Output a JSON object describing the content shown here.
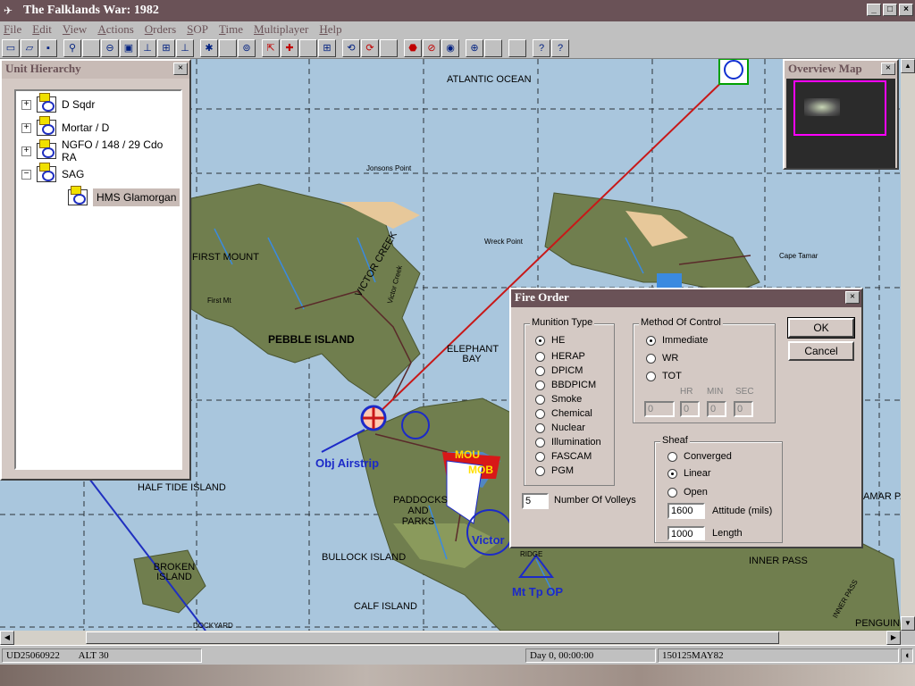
{
  "window": {
    "title": "The Falklands War: 1982",
    "min": "_",
    "max": "□",
    "close": "×"
  },
  "menu": [
    "File",
    "Edit",
    "View",
    "Actions",
    "Orders",
    "SOP",
    "Time",
    "Multiplayer",
    "Help"
  ],
  "toolbar_icons": [
    "new-icon",
    "open-icon",
    "save-icon",
    "binoculars-icon",
    "blank-icon",
    "zoom-icon",
    "select-icon",
    "unit-icon",
    "org-icon",
    "org2-icon",
    "org3-icon",
    "sun-icon",
    "blank2-icon",
    "clock-icon",
    "move-icon",
    "add-icon",
    "blank3-icon",
    "grid-icon",
    "cycle-icon",
    "cycle2-icon",
    "blank4-icon",
    "stop-icon",
    "cancel-icon",
    "eye-icon",
    "target-icon",
    "blank5-icon",
    "blank6-icon",
    "help-icon",
    "whatsthis-icon"
  ],
  "hierarchy": {
    "title": "Unit Hierarchy",
    "items": [
      {
        "label": "D Sqdr",
        "expander": "+"
      },
      {
        "label": "Mortar / D",
        "expander": "+"
      },
      {
        "label": "NGFO / 148 / 29 Cdo RA",
        "expander": "+"
      },
      {
        "label": "SAG",
        "expander": "−"
      },
      {
        "label": "HMS Glamorgan",
        "expander": ""
      }
    ]
  },
  "overview": {
    "title": "Overview Map"
  },
  "map_labels": {
    "atlantic": "ATLANTIC OCEAN",
    "jonsons": "Jonsons Point",
    "wreck": "Wreck Point",
    "cape": "Cape Tamar",
    "first_mount": "FIRST MOUNT",
    "first_mt": "First Mt",
    "victor_creek": "VICTOR CREEK",
    "victor_creek2": "Victor Creek",
    "pebble": "PEBBLE ISLAND",
    "elephant": "ELEPHANT BAY",
    "obj": "Obj Airstrip",
    "half_tide": "HALF TIDE ISLAND",
    "paddocks": "PADDOCKS AND PARKS",
    "broken": "BROKEN ISLAND",
    "bullock": "BULLOCK ISLAND",
    "calf": "CALF ISLAND",
    "dockyard": "DOCKYARD",
    "mt_tp_op": "Mt Tp OP",
    "victor": "Victor",
    "ridge": "RIDGE",
    "inner_pass": "INNER PASS",
    "inner_pass2": "INNER PASS",
    "penguin": "PENGUIN",
    "tamar_pass": "AMAR PA",
    "mou": "MOU",
    "mob": "MOB"
  },
  "fire_order": {
    "title": "Fire Order",
    "munition_title": "Munition Type",
    "munitions": [
      "HE",
      "HERAP",
      "DPICM",
      "BBDPICM",
      "Smoke",
      "Chemical",
      "Nuclear",
      "Illumination",
      "FASCAM",
      "PGM"
    ],
    "munition_selected": "HE",
    "moc_title": "Method Of Control",
    "moc": [
      "Immediate",
      "WR",
      "TOT"
    ],
    "moc_selected": "Immediate",
    "time_labels": [
      "HR",
      "MIN",
      "SEC"
    ],
    "time_values": [
      "0",
      "0",
      "0",
      "0"
    ],
    "sheaf_title": "Sheaf",
    "sheaf": [
      "Converged",
      "Linear",
      "Open"
    ],
    "sheaf_selected": "Linear",
    "volleys_value": "5",
    "volleys_label": "Number Of Volleys",
    "attitude_value": "1600",
    "attitude_label": "Attitude (mils)",
    "length_value": "1000",
    "length_label": "Length",
    "ok": "OK",
    "cancel": "Cancel"
  },
  "status": {
    "coords": "UD25060922",
    "alt": "ALT 30",
    "day": "Day 0, 00:00:00",
    "dtg": "150125MAY82"
  }
}
